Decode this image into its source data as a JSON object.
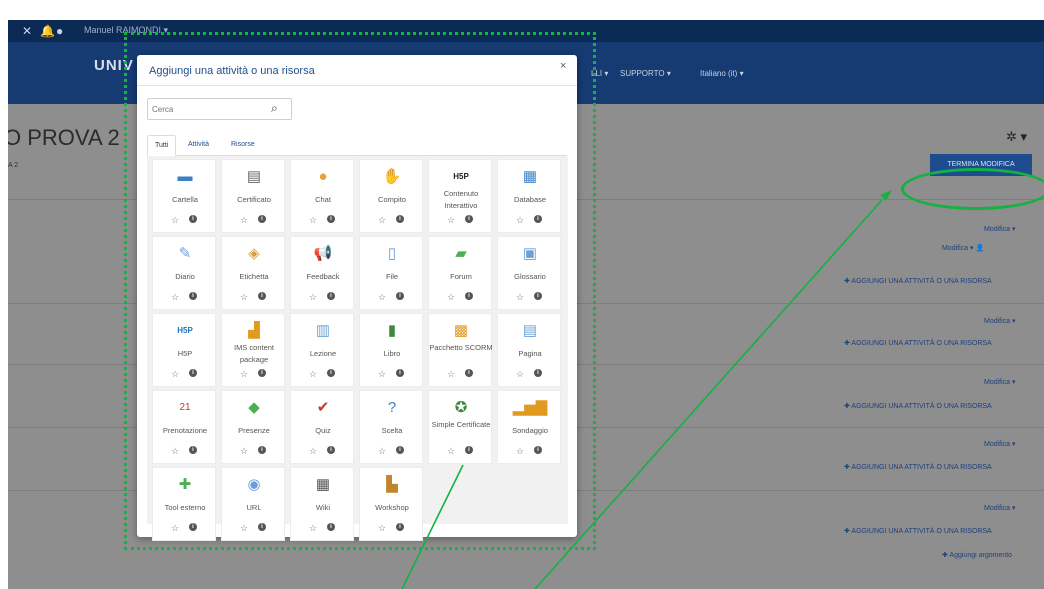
{
  "topbar": {
    "user_name": "Manuel RAIMONDI ▾"
  },
  "navbar": {
    "brand": "UNIV",
    "items": [
      "LLI ▾",
      "SUPPORTO ▾",
      "Italiano (it) ▾"
    ]
  },
  "course": {
    "title": "O PROVA 2",
    "breadcrumb": "A 2",
    "finish_edit_label": "TERMINA MODIFICA"
  },
  "sections": {
    "edit_label": "Modifica ▾",
    "edit_user_label": "Modifica ▾ 👤",
    "add_label": "✚ AGGIUNGI UNA ATTIVITÀ O UNA RISORSA",
    "add_topic_label": "✚ Aggiungi argomento"
  },
  "modal": {
    "title": "Aggiungi una attività o una risorsa",
    "close": "×",
    "search_placeholder": "Cerca",
    "tabs": [
      "Tutti",
      "Attività",
      "Risorse"
    ],
    "tiles": [
      {
        "label": "Cartella",
        "icon": "folder-icon",
        "glyph": "▬",
        "color": "#3b82c4"
      },
      {
        "label": "Certificato",
        "icon": "certificate-icon",
        "glyph": "▤",
        "color": "#666666"
      },
      {
        "label": "Chat",
        "icon": "chat-icon",
        "glyph": "●",
        "color": "#e8a13a"
      },
      {
        "label": "Compito",
        "icon": "assignment-icon",
        "glyph": "✋",
        "color": "#d9a066"
      },
      {
        "label": "Contenuto Interattivo",
        "icon": "h5p-interactive-icon",
        "glyph": "H5P",
        "color": "#222222"
      },
      {
        "label": "Database",
        "icon": "database-icon",
        "glyph": "▦",
        "color": "#3b82c4"
      },
      {
        "label": "Diario",
        "icon": "journal-icon",
        "glyph": "✎",
        "color": "#6aa0d8"
      },
      {
        "label": "Etichetta",
        "icon": "label-icon",
        "glyph": "◈",
        "color": "#d8a040"
      },
      {
        "label": "Feedback",
        "icon": "feedback-icon",
        "glyph": "📢",
        "color": "#c0392b"
      },
      {
        "label": "File",
        "icon": "file-icon",
        "glyph": "▯",
        "color": "#6aa0d8"
      },
      {
        "label": "Forum",
        "icon": "forum-icon",
        "glyph": "▰",
        "color": "#4caf50"
      },
      {
        "label": "Glossario",
        "icon": "glossary-icon",
        "glyph": "▣",
        "color": "#6aa0d8"
      },
      {
        "label": "H5P",
        "icon": "h5p-icon",
        "glyph": "H5P",
        "color": "#1e73be"
      },
      {
        "label": "IMS content package",
        "icon": "ims-package-icon",
        "glyph": "▟",
        "color": "#e09a1e"
      },
      {
        "label": "Lezione",
        "icon": "lesson-icon",
        "glyph": "▥",
        "color": "#6aa0d8"
      },
      {
        "label": "Libro",
        "icon": "book-icon",
        "glyph": "▮",
        "color": "#3c8a3c"
      },
      {
        "label": "Pacchetto SCORM",
        "icon": "scorm-icon",
        "glyph": "▩",
        "color": "#e09a1e"
      },
      {
        "label": "Pagina",
        "icon": "page-icon",
        "glyph": "▤",
        "color": "#6aa0d8"
      },
      {
        "label": "Prenotazione",
        "icon": "calendar-icon",
        "glyph": "21",
        "color": "#c0392b"
      },
      {
        "label": "Presenze",
        "icon": "attendance-icon",
        "glyph": "◆",
        "color": "#4caf50"
      },
      {
        "label": "Quiz",
        "icon": "quiz-icon",
        "glyph": "✔",
        "color": "#c0392b"
      },
      {
        "label": "Scelta",
        "icon": "choice-icon",
        "glyph": "?",
        "color": "#3b82c4"
      },
      {
        "label": "Simple Certificate",
        "icon": "simple-certificate-icon",
        "glyph": "✪",
        "color": "#3c8a3c"
      },
      {
        "label": "Sondaggio",
        "icon": "survey-icon",
        "glyph": "▂▅▇",
        "color": "#e09a1e"
      },
      {
        "label": "Tool esterno",
        "icon": "external-tool-icon",
        "glyph": "✚",
        "color": "#4caf50"
      },
      {
        "label": "URL",
        "icon": "url-icon",
        "glyph": "◉",
        "color": "#6aa0d8"
      },
      {
        "label": "Wiki",
        "icon": "wiki-icon",
        "glyph": "▦",
        "color": "#555555"
      },
      {
        "label": "Workshop",
        "icon": "workshop-icon",
        "glyph": "▙",
        "color": "#c0862b"
      }
    ]
  },
  "colors": {
    "highlight": "#13b241",
    "accent": "#1e4d8f",
    "navbar": "#163a72"
  }
}
